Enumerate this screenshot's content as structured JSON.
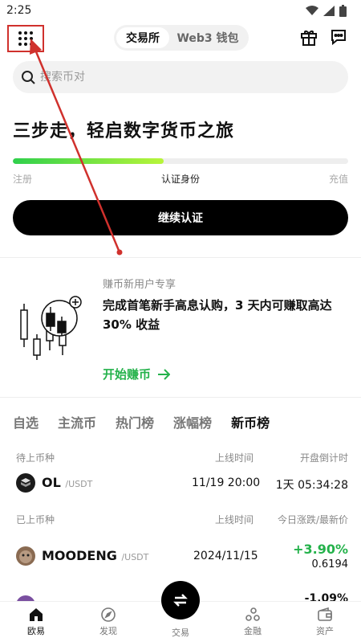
{
  "status": {
    "time": "2:25"
  },
  "header": {
    "segment_active": "交易所",
    "segment_other": "Web3 钱包"
  },
  "search": {
    "placeholder": "搜索币对"
  },
  "hero": {
    "title": "三步走，轻启数字货币之旅",
    "progress": 0.45,
    "step1": "注册",
    "step2": "认证身份",
    "step3": "充值",
    "cta_label": "继续认证"
  },
  "promo": {
    "label": "赚币新用户专享",
    "text": "完成首笔新手高息认购，3 天内可赚取高达 30% 收益",
    "link": "开始赚币"
  },
  "tabs": [
    "自选",
    "主流币",
    "热门榜",
    "涨幅榜",
    "新币榜"
  ],
  "pending": {
    "h1": "待上币种",
    "h2": "上线时间",
    "h3": "开盘倒计时",
    "coin": "OL",
    "quote": "/USDT",
    "time": "11/19 20:00",
    "countdown": "1天 05:34:28"
  },
  "listed": {
    "h1": "已上币种",
    "h2": "上线时间",
    "h3": "今日涨跌/最新价",
    "rows": [
      {
        "coin": "MOODENG",
        "quote": "/USDT",
        "date": "2024/11/15",
        "change": "+3.90%",
        "price": "0.6194"
      },
      {
        "change": "-1.09%"
      }
    ]
  },
  "nav": {
    "home": "欧易",
    "discover": "发现",
    "trade": "交易",
    "finance": "金融",
    "assets": "资产"
  },
  "colors": {
    "accent_green": "#24b24b",
    "down_red": "#e0384b",
    "annotation_red": "#d0312d"
  }
}
